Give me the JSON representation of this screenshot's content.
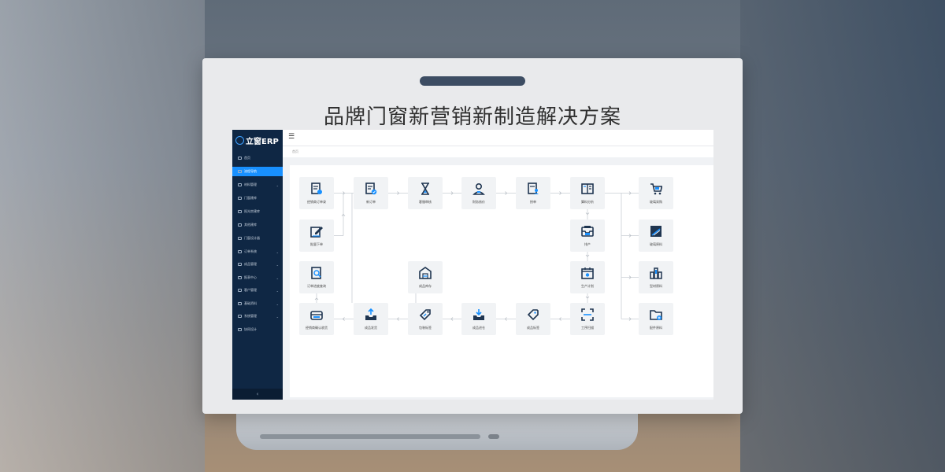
{
  "title": "品牌门窗新营销新制造解决方案",
  "app": {
    "logo_text": "立窗ERP",
    "sidebar": [
      {
        "label": "首页",
        "caret": false
      },
      {
        "label": "流程导航",
        "caret": false,
        "active": true
      },
      {
        "label": "材料管理",
        "caret": true
      },
      {
        "label": "门窗建库",
        "caret": false
      },
      {
        "label": "阳光房建库",
        "caret": false
      },
      {
        "label": "其他建库",
        "caret": false
      },
      {
        "label": "门窗设计器",
        "caret": false
      },
      {
        "label": "订单系统",
        "caret": true
      },
      {
        "label": "成品管理",
        "caret": true
      },
      {
        "label": "报表中心",
        "caret": true
      },
      {
        "label": "客户管理",
        "caret": true
      },
      {
        "label": "基础资料",
        "caret": true
      },
      {
        "label": "系统管理",
        "caret": true
      },
      {
        "label": "协同设计",
        "caret": false
      }
    ],
    "collapse_glyph": "‹",
    "menu_toggle_glyph": "☰",
    "breadcrumb": "首页",
    "flow": [
      {
        "id": "n1",
        "label": "经销商订单录",
        "icon": "document-edit-icon"
      },
      {
        "id": "n2",
        "label": "新订单",
        "icon": "document-check-icon"
      },
      {
        "id": "n3",
        "label": "客服审核",
        "icon": "hourglass-icon"
      },
      {
        "id": "n4",
        "label": "财务核价",
        "icon": "user-icon"
      },
      {
        "id": "n5",
        "label": "授单",
        "icon": "document-person-icon"
      },
      {
        "id": "n6",
        "label": "算料分析",
        "icon": "book-icon"
      },
      {
        "id": "n7",
        "label": "玻璃采购",
        "icon": "cart-icon"
      },
      {
        "id": "n8",
        "label": "批量下单",
        "icon": "pen-icon"
      },
      {
        "id": "n9",
        "label": "排产",
        "icon": "inbox-icon"
      },
      {
        "id": "n10",
        "label": "玻璃原料",
        "icon": "glass-icon"
      },
      {
        "id": "n11",
        "label": "订单进度查询",
        "icon": "search-doc-icon"
      },
      {
        "id": "n12",
        "label": "成品库存",
        "icon": "warehouse-icon"
      },
      {
        "id": "n13",
        "label": "生产计划",
        "icon": "calendar-icon"
      },
      {
        "id": "n14",
        "label": "型材原料",
        "icon": "profiles-icon"
      },
      {
        "id": "n15",
        "label": "经销商确认收货",
        "icon": "box-open-icon"
      },
      {
        "id": "n16",
        "label": "成品发货",
        "icon": "tray-out-icon"
      },
      {
        "id": "n17",
        "label": "包装标签",
        "icon": "tag-icon"
      },
      {
        "id": "n18",
        "label": "成品进仓",
        "icon": "tray-in-icon"
      },
      {
        "id": "n19",
        "label": "成品标签",
        "icon": "label-icon"
      },
      {
        "id": "n20",
        "label": "工序扫描",
        "icon": "scan-icon"
      },
      {
        "id": "n21",
        "label": "配件原料",
        "icon": "folder-icon"
      }
    ]
  },
  "colors": {
    "accent": "#1890ff",
    "icon_dark": "#1f3550",
    "sidebar_bg": "#0f2744"
  }
}
